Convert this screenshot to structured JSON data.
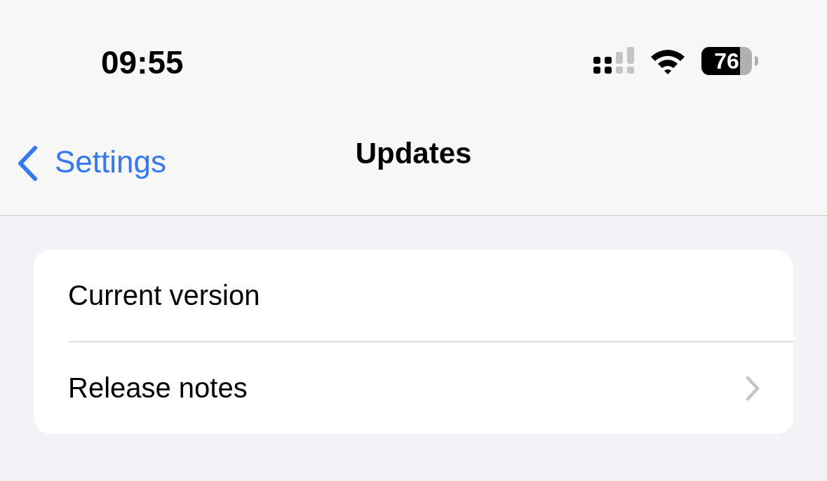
{
  "status_bar": {
    "time": "09:55",
    "battery": "76"
  },
  "nav_bar": {
    "back": "Settings",
    "title": "Updates"
  },
  "rows": [
    {
      "label": "Current version",
      "kind": "plain"
    },
    {
      "label": "Release notes",
      "kind": "link"
    }
  ]
}
